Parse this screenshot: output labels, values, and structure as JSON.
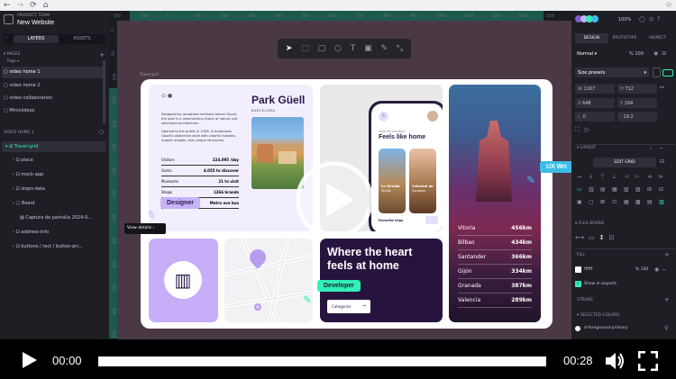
{
  "app": {
    "team": "PRODUCT TEAM",
    "project": "New Website",
    "tabs": [
      "LAYERS",
      "ASSETS"
    ],
    "pages_label": "PAGES",
    "page_select": "Page",
    "pages": [
      "video home 1",
      "video home 2",
      "video collaboration",
      "Miniviideos"
    ],
    "layers_header": "VIDEO HOME 1",
    "layers": [
      "Travel-grid",
      "place",
      "mock-app",
      "steps-data",
      "Board",
      "Captura de pantalla 2024-0...",
      "address-info",
      "buttons / rect / button-pri..."
    ]
  },
  "ruler_numbers": [
    "-200",
    "-100",
    "0",
    "100",
    "200",
    "300",
    "400",
    "500",
    "600",
    "700",
    "800",
    "900",
    "1000",
    "1100",
    "1200",
    "1300",
    "1400"
  ],
  "vruler_numbers": [
    "0",
    "50",
    "100",
    "150",
    "200",
    "250",
    "300",
    "350",
    "400",
    "450",
    "500",
    "550",
    "600",
    "650"
  ],
  "board_label": "Travel grid",
  "right": {
    "zoom": "100%",
    "tabs": [
      "DESIGN",
      "PROTOTYPE",
      "INSPECT"
    ],
    "blend": "Normal",
    "opacity": "% 100",
    "size_presets": "Size presets",
    "w": "1167",
    "h": "712",
    "x": "648",
    "y": "164",
    "rotation": "0",
    "radius": "19.2",
    "layout_header": "LAYOUT",
    "edit_grid": "EDIT GRID",
    "flex_board_header": "FLEX BOARD",
    "fill_header": "FILL",
    "fill_hex": "ffffff",
    "fill_opacity": "% 100",
    "show_in_exports": "Show in exports",
    "stroke_header": "STROKE",
    "selected_colors_header": "SELECTED COLORS",
    "selected_color": "d-foreground-primary"
  },
  "park": {
    "title": "Park Güell",
    "subtitle": "BARCELONA",
    "desc1": "Designed by renowned architect Antoni Gaudí, the park is a mesmerizing fusion of nature and whimsical architecture.",
    "desc2": "Opened to the public in 1926, it showcases Gaudí's distinctive style with colorful mosaics, organic shapes, and unique structures.",
    "stats": [
      {
        "label": "Visitors",
        "value": "224.095 /day"
      },
      {
        "label": "Gems",
        "value": "4.055 to discover"
      },
      {
        "label": "Museums",
        "value": "21 to visit"
      },
      {
        "label": "Shops",
        "value": "1266 brands"
      },
      {
        "label": "Transport",
        "value": "Metro ave bus"
      }
    ],
    "view_details": "View details"
  },
  "phone": {
    "small": "Visit the wonders",
    "title": "Feels like home",
    "cards": [
      {
        "name": "La Giralda",
        "city": "Sevilla"
      },
      {
        "name": "Catedral de",
        "city": "Zaragoza"
      }
    ],
    "favorite": "Favorite trips"
  },
  "cities": [
    {
      "name": "Vitoria",
      "km": "456km"
    },
    {
      "name": "Bilbao",
      "km": "434km"
    },
    {
      "name": "Santander",
      "km": "366km"
    },
    {
      "name": "Gijón",
      "km": "334km"
    },
    {
      "name": "Granada",
      "km": "387km"
    },
    {
      "name": "Valencia",
      "km": "289km"
    }
  ],
  "heart": {
    "title": "Where the heart feels at home",
    "button": "Categories"
  },
  "cursors": {
    "designer": "Designer",
    "developer": "Developer",
    "ux": "UX Wri"
  },
  "colors": {
    "accent": "#31efb8",
    "designer": "#c6b3f7",
    "ux": "#3dbde6"
  },
  "player": {
    "current_time": "00:00",
    "duration": "00:28",
    "progress": 0
  }
}
